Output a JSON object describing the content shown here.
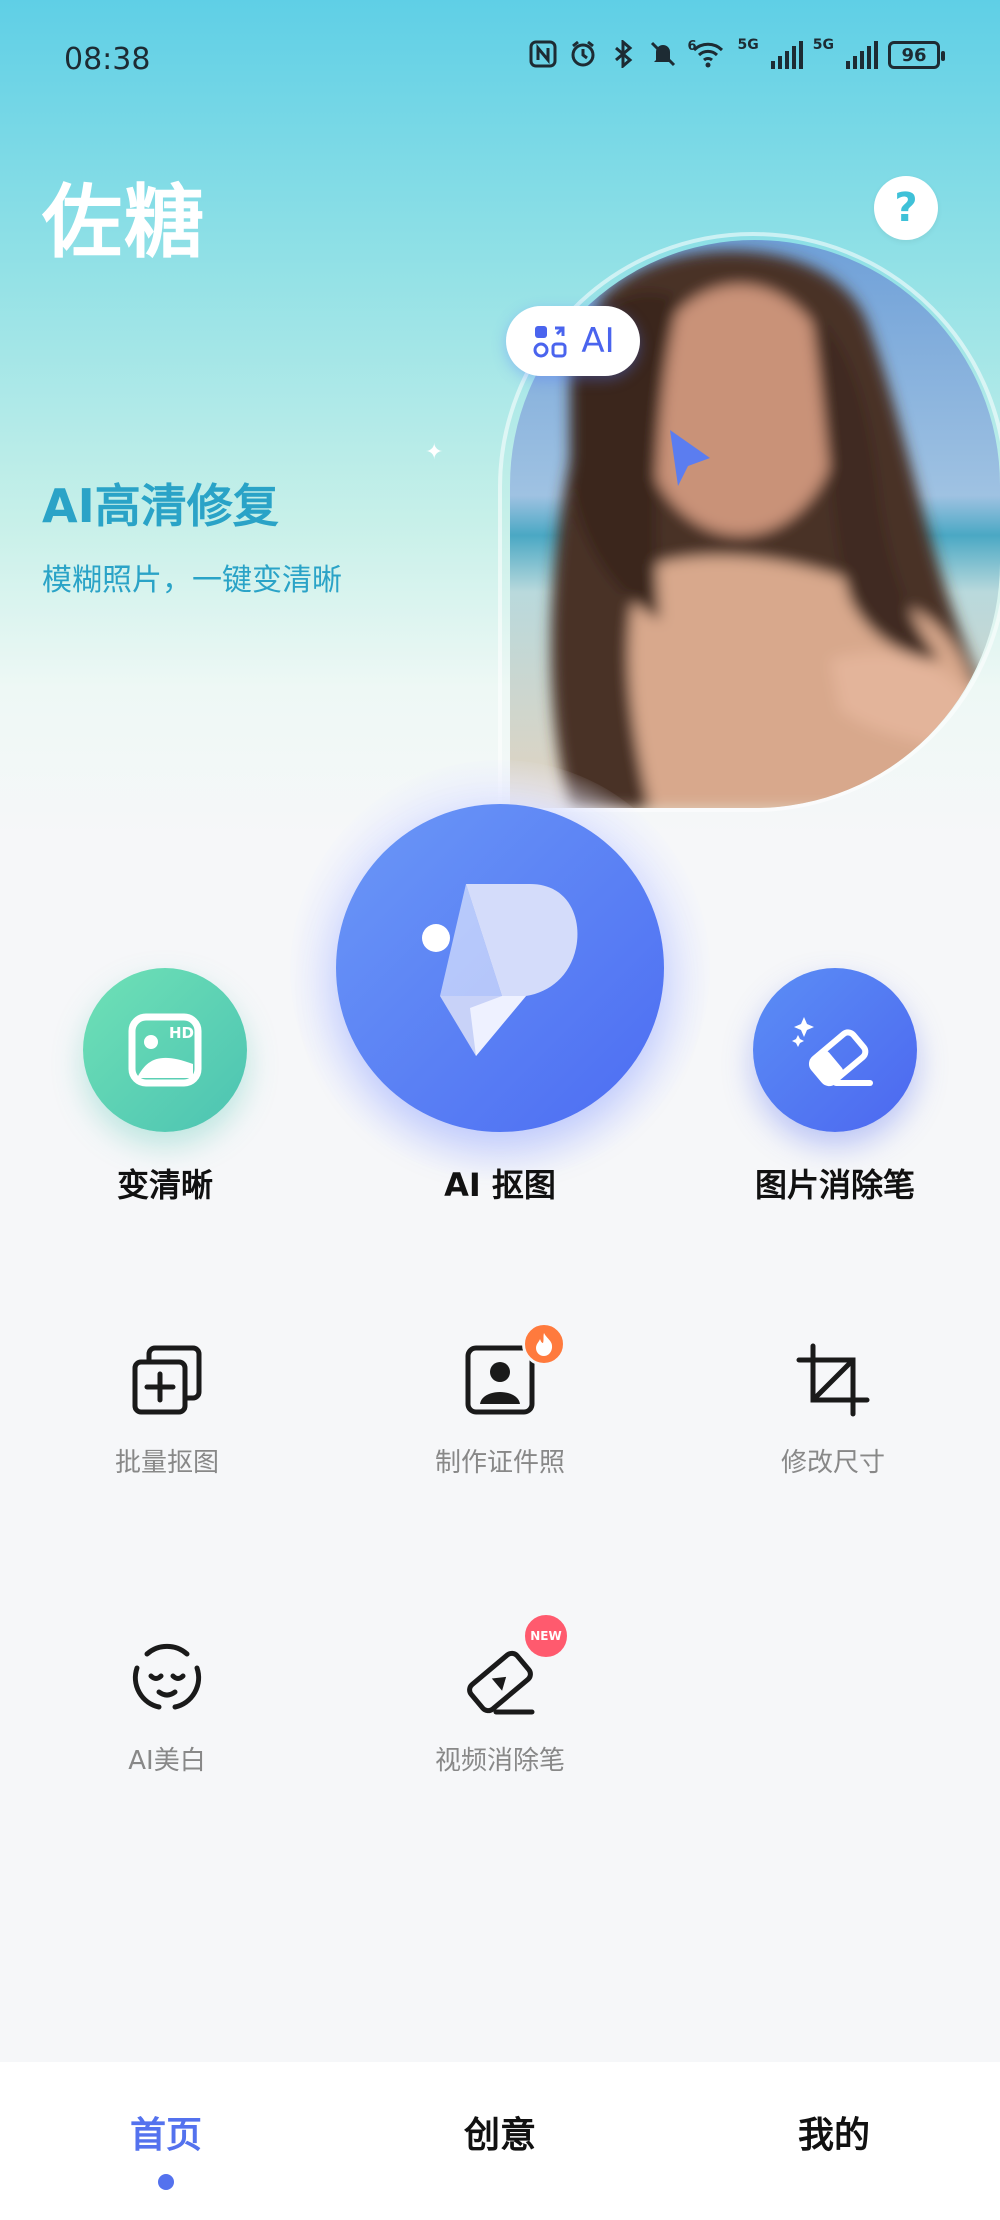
{
  "status_bar": {
    "time": "08:38",
    "icons": [
      "nfc-icon",
      "alarm-icon",
      "bluetooth-icon",
      "mute-icon",
      "wifi-icon",
      "signal-5g-icon",
      "signal-5g-icon"
    ],
    "wifi_tag": "6",
    "net_tag_1": "5G",
    "net_tag_2": "5G",
    "battery": "96"
  },
  "header": {
    "title": "佐糖",
    "help_label": "?"
  },
  "banner": {
    "title": "AI高清修复",
    "subtitle": "模糊照片，一键变清晰",
    "ai_badge": "AI"
  },
  "main_tools": {
    "left_label": "变清晰",
    "center_label": "AI 抠图",
    "right_label": "图片消除笔",
    "hd_tag": "HD"
  },
  "grid_tools": [
    {
      "label": "批量抠图",
      "icon": "batch-cutout-icon"
    },
    {
      "label": "制作证件照",
      "icon": "id-photo-icon",
      "badge": "fire"
    },
    {
      "label": "修改尺寸",
      "icon": "crop-icon"
    },
    {
      "label": "AI美白",
      "icon": "face-whitening-icon"
    },
    {
      "label": "视频消除笔",
      "icon": "video-eraser-icon",
      "badge": "NEW"
    }
  ],
  "bottom_nav": {
    "items": [
      {
        "label": "首页",
        "active": true
      },
      {
        "label": "创意",
        "active": false
      },
      {
        "label": "我的",
        "active": false
      }
    ]
  },
  "colors": {
    "accent": "#5472ee",
    "banner_text": "#2aa3c7",
    "hero_top": "#5fcfe6"
  }
}
